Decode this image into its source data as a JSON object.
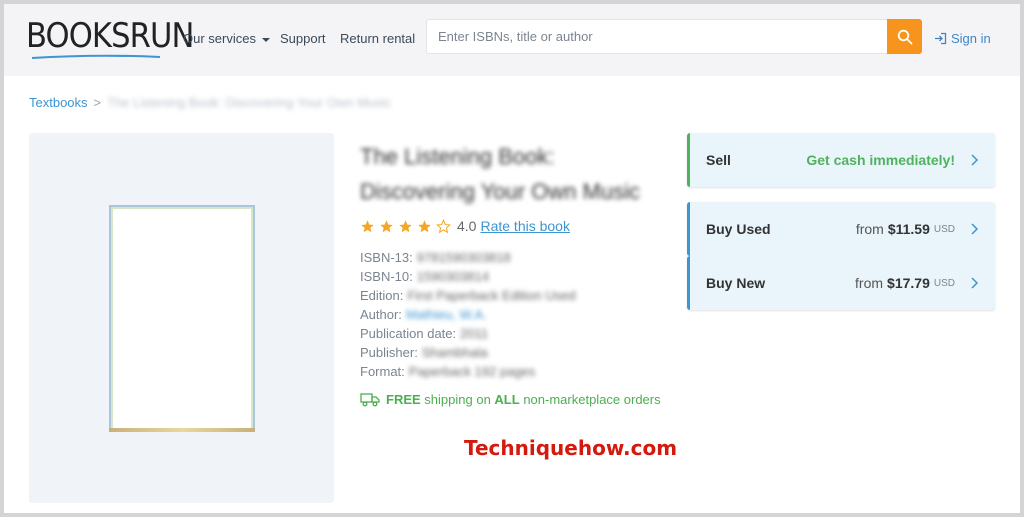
{
  "header": {
    "logo_text": "BOOKSRUN",
    "nav": {
      "services": "Our services",
      "support": "Support",
      "return_rental": "Return rental"
    },
    "search_placeholder": "Enter ISBNs, title or author",
    "signin": "Sign in"
  },
  "breadcrumb": {
    "root": "Textbooks",
    "separator": ">",
    "current": "The Listening Book: Discovering Your Own Music"
  },
  "book": {
    "title_line1": "The Listening Book:",
    "title_line2": "Discovering Your Own Music",
    "rating_value": "4.0",
    "rating": 4,
    "rate_link": "Rate this book",
    "details": [
      {
        "label": "ISBN-13:",
        "value": "9781590303818"
      },
      {
        "label": "ISBN-10:",
        "value": "1590303814"
      },
      {
        "label": "Edition:",
        "value": "First Paperback Edition Used"
      },
      {
        "label": "Author:",
        "value": "Mathieu, W.A."
      },
      {
        "label": "Publication date:",
        "value": "2011"
      },
      {
        "label": "Publisher:",
        "value": "Shambhala"
      },
      {
        "label": "Format:",
        "value": "Paperback 192 pages"
      }
    ],
    "shipping": {
      "free": "FREE",
      "middle": "shipping on",
      "all": "ALL",
      "end": "non-marketplace orders"
    }
  },
  "offers": {
    "sell": {
      "label": "Sell",
      "tag": "Get cash immediately!"
    },
    "used": {
      "label": "Buy Used",
      "from": "from",
      "price": "$11.59",
      "currency": "USD"
    },
    "new": {
      "label": "Buy New",
      "from": "from",
      "price": "$17.79",
      "currency": "USD"
    }
  },
  "watermark": "Techniquehow.com",
  "colors": {
    "accent_orange": "#f7941d",
    "link_blue": "#3d96d1",
    "green": "#50b25c",
    "star": "#f5a623"
  }
}
